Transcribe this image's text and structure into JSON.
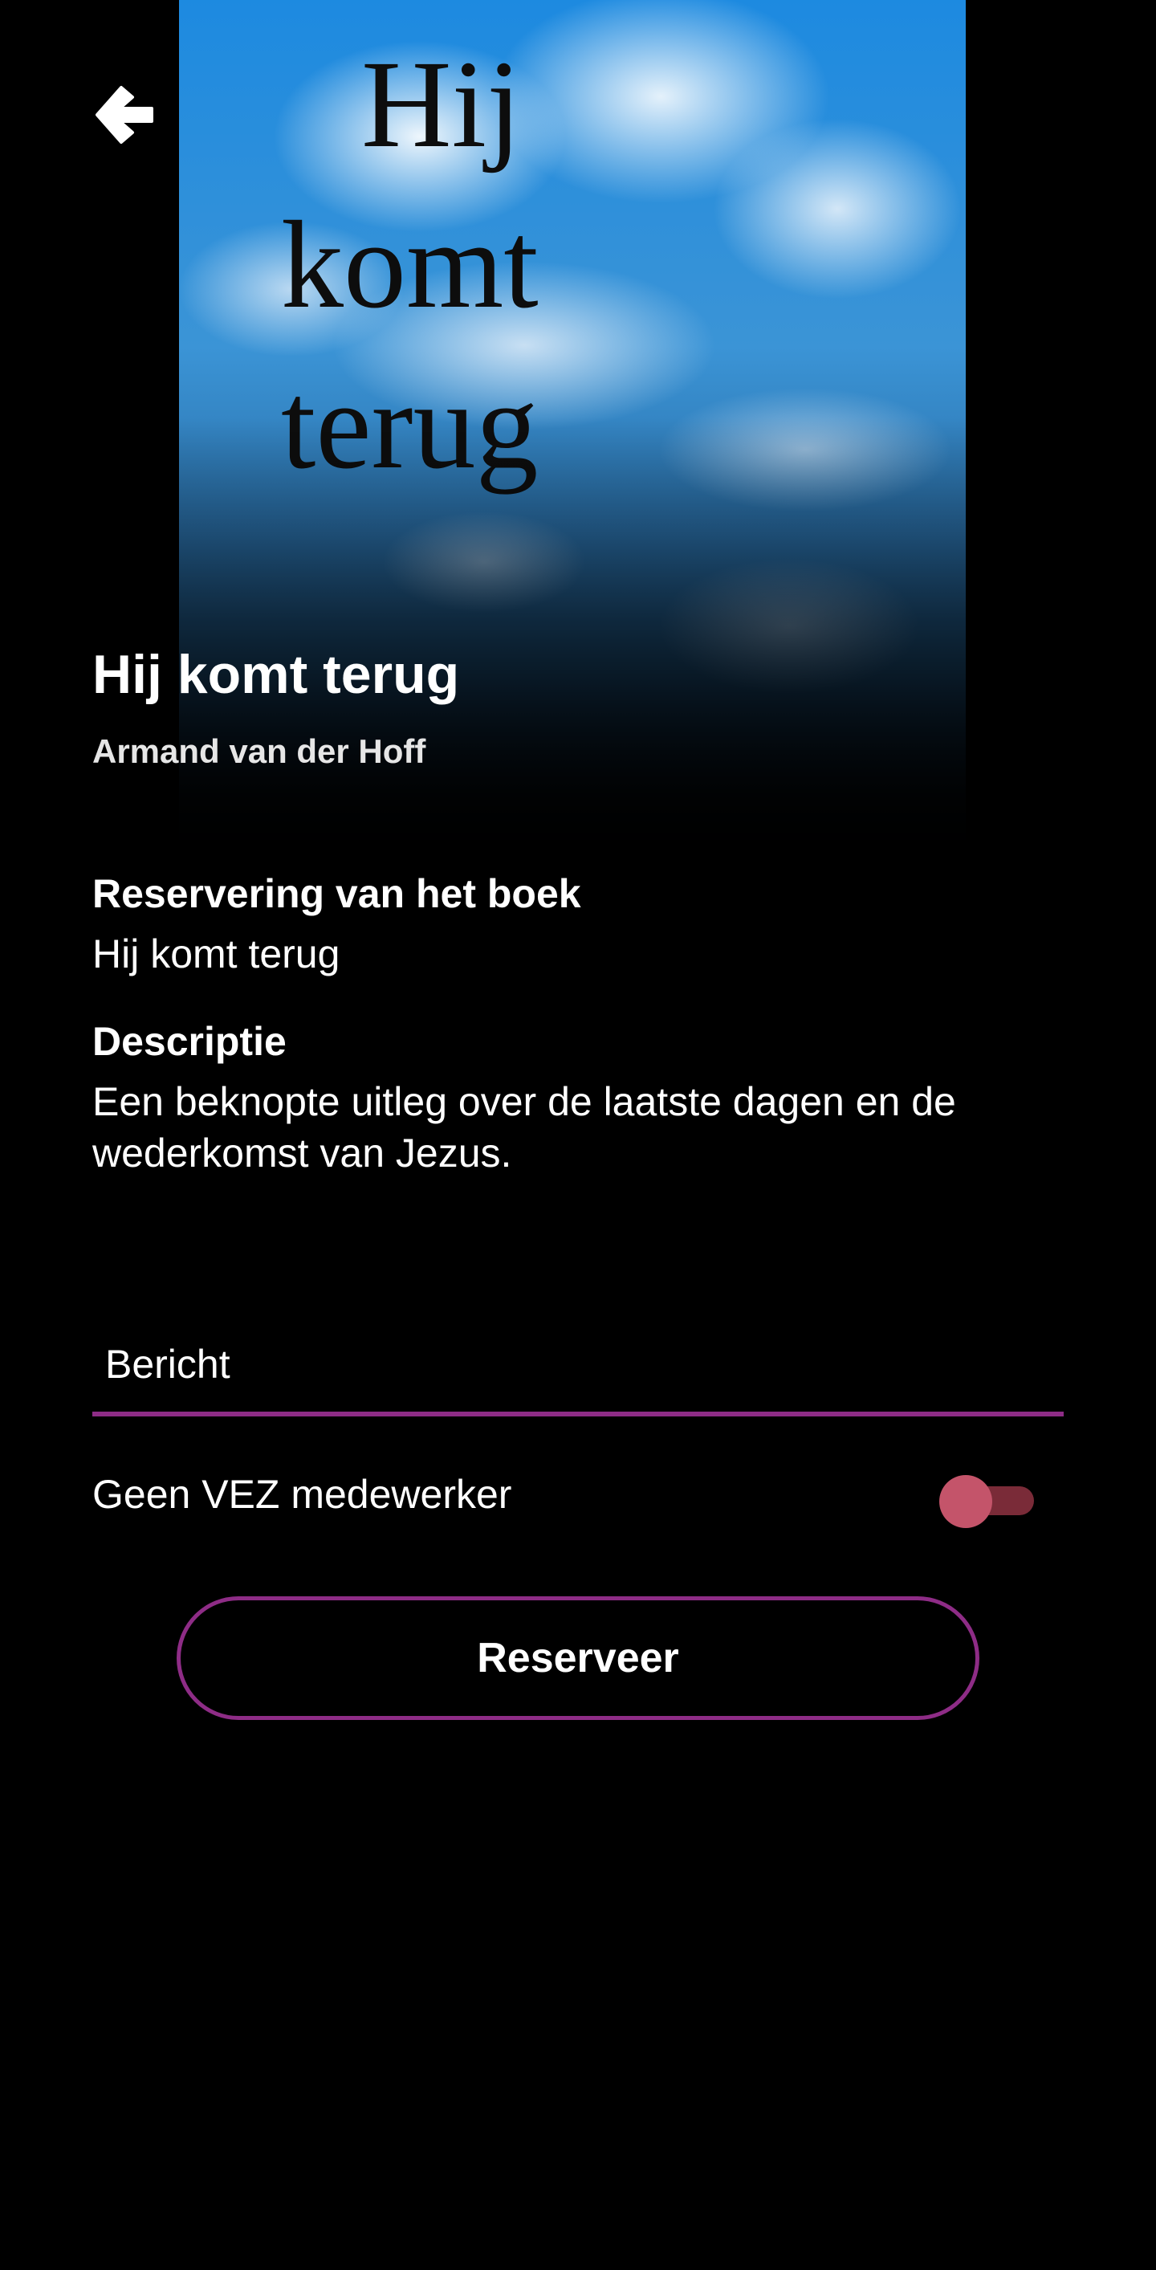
{
  "cover": {
    "title_line_1": "Hij",
    "title_line_2": "komt",
    "title_line_3": "terug"
  },
  "header": {
    "back_icon": "arrow-left-icon",
    "title": "Hij komt terug",
    "author": "Armand van der Hoff"
  },
  "details": {
    "reservation_label": "Reservering van het boek",
    "reservation_value": "Hij komt terug",
    "description_label": "Descriptie",
    "description_value": "Een beknopte uitleg over de laatste dagen en de wederkomst van Jezus."
  },
  "form": {
    "message_placeholder": "Bericht",
    "message_value": "",
    "toggle_label": "Geen VEZ medewerker",
    "toggle_on": false,
    "submit_label": "Reserveer"
  },
  "colors": {
    "background": "#000000",
    "accent": "#8e2c86",
    "toggle_thumb": "#c4546a",
    "toggle_track": "#7a2b38"
  }
}
